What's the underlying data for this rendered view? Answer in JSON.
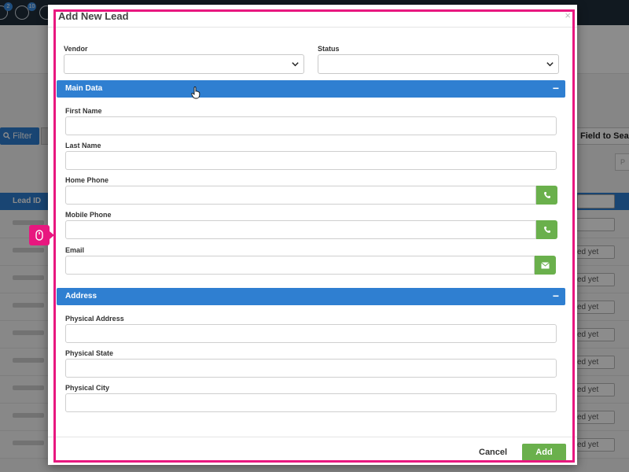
{
  "background": {
    "badges": [
      "2",
      "10"
    ],
    "filter_label": "Filter",
    "field_search_label": "Field to Search",
    "small_box_placeholder": "P",
    "table_header": "Lead ID",
    "row_select_text": "ed yet",
    "rows": 9
  },
  "modal": {
    "title": "Add New Lead",
    "close": "×",
    "vendor_label": "Vendor",
    "status_label": "Status",
    "sections": {
      "main": {
        "title": "Main Data",
        "toggle": "−"
      },
      "address": {
        "title": "Address",
        "toggle": "−"
      }
    },
    "fields": {
      "first_name": "First Name",
      "last_name": "Last Name",
      "home_phone": "Home Phone",
      "mobile_phone": "Mobile Phone",
      "email": "Email",
      "physical_address": "Physical Address",
      "physical_state": "Physical State",
      "physical_city": "Physical City"
    },
    "cancel_label": "Cancel",
    "add_label": "Add"
  },
  "colors": {
    "primary": "#2f7fd1",
    "success": "#6ab04c",
    "highlight": "#e8177f",
    "topbar": "#1f2e3b"
  },
  "icons": [
    "phone-icon",
    "envelope-icon",
    "chevron-down-icon",
    "mouse-icon",
    "hand-cursor-icon",
    "search-icon"
  ]
}
